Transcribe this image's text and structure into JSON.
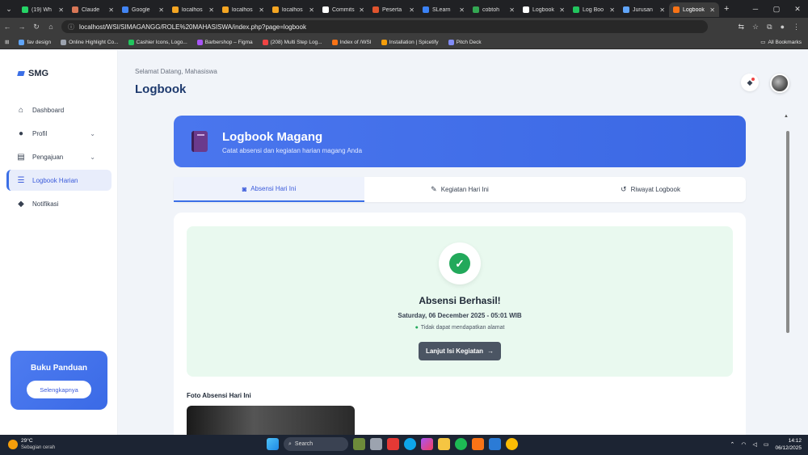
{
  "browser": {
    "tabs": [
      {
        "title": "(19) Wh",
        "color": "#25d366"
      },
      {
        "title": "Claude",
        "color": "#d97757"
      },
      {
        "title": "Google",
        "color": "#4285f4"
      },
      {
        "title": "localhos",
        "color": "#f5a623"
      },
      {
        "title": "localhos",
        "color": "#f5a623"
      },
      {
        "title": "localhos",
        "color": "#f5a623"
      },
      {
        "title": "Commits",
        "color": "#ffffff"
      },
      {
        "title": "Peserta",
        "color": "#e0542e"
      },
      {
        "title": "SLearn",
        "color": "#3b82f6"
      },
      {
        "title": "cobtoh",
        "color": "#34a853"
      },
      {
        "title": "Logbook",
        "color": "#ffffff"
      },
      {
        "title": "Log Boo",
        "color": "#22c55e"
      },
      {
        "title": "Jurusan",
        "color": "#60a5fa"
      },
      {
        "title": "Logbook",
        "color": "#f97316",
        "active": true
      }
    ],
    "url": "localhost/WSI/SIMAGANGG/ROLE%20MAHASISWA/index.php?page=logbook",
    "bookmarks": [
      {
        "label": "fav design",
        "color": "#60a5fa"
      },
      {
        "label": "Online Highlight Co...",
        "color": "#9ca3af"
      },
      {
        "label": "Cashier Icons, Logo...",
        "color": "#22c55e"
      },
      {
        "label": "Barbershop – Figma",
        "color": "#a855f7"
      },
      {
        "label": "(208) Multi Step Log...",
        "color": "#ef4444"
      },
      {
        "label": "Index of /WSI",
        "color": "#f97316"
      },
      {
        "label": "Installation | Spicetify",
        "color": "#f59e0b"
      },
      {
        "label": "Pitch Deck",
        "color": "#818cf8"
      }
    ],
    "all_bookmarks": "All Bookmarks"
  },
  "sidebar": {
    "brand": "SMG",
    "items": [
      {
        "label": "Dashboard",
        "icon": "home-icon",
        "glyph": "⌂"
      },
      {
        "label": "Profil",
        "icon": "user-icon",
        "glyph": "●",
        "chevron": true
      },
      {
        "label": "Pengajuan",
        "icon": "file-icon",
        "glyph": "▤",
        "chevron": true
      },
      {
        "label": "Logbook Harian",
        "icon": "list-icon",
        "glyph": "☰",
        "active": true
      },
      {
        "label": "Notifikasi",
        "icon": "bell-icon",
        "glyph": "◆"
      }
    ],
    "guide": {
      "title": "Buku Panduan",
      "button": "Selengkapnya"
    }
  },
  "header": {
    "welcome": "Selamat Datang, Mahasiswa",
    "title": "Logbook"
  },
  "banner": {
    "title": "Logbook Magang",
    "subtitle": "Catat absensi dan kegiatan harian magang Anda"
  },
  "tabs": [
    {
      "label": "Absensi Hari Ini",
      "icon": "camera-icon",
      "active": true
    },
    {
      "label": "Kegiatan Hari Ini",
      "icon": "edit-icon"
    },
    {
      "label": "Riwayat Logbook",
      "icon": "history-icon"
    }
  ],
  "success": {
    "title": "Absensi Berhasil!",
    "datetime": "Saturday, 06 December 2025 - 05:01 WIB",
    "location": "Tidak dapat mendapatkan alamat",
    "button": "Lanjut Isi Kegiatan"
  },
  "photo_label": "Foto Absensi Hari Ini",
  "taskbar": {
    "temp": "29°C",
    "weather": "Sebagian cerah",
    "search": "Search",
    "time": "14:12",
    "date": "06/12/2025"
  }
}
